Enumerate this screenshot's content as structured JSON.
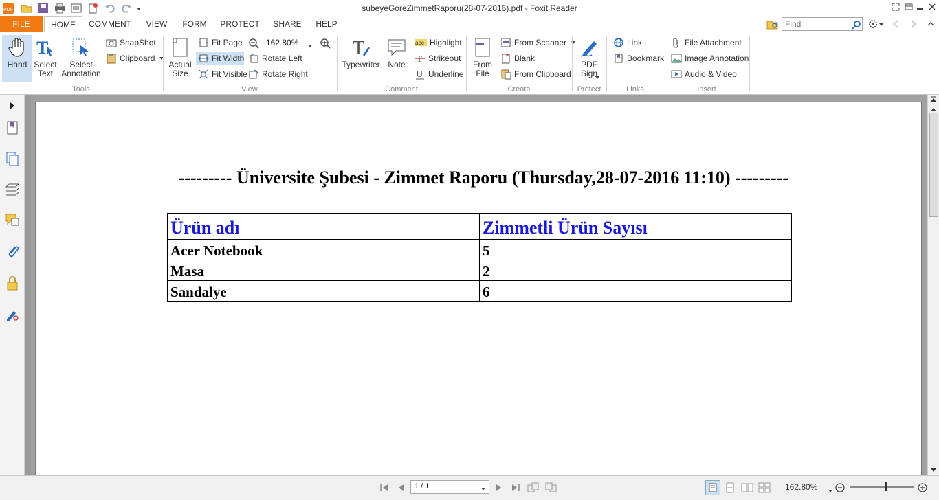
{
  "window": {
    "title": "subeyeGoreZimmetRaporu(28-07-2016).pdf - Foxit Reader"
  },
  "tabs": {
    "file": "FILE",
    "items": [
      "HOME",
      "COMMENT",
      "VIEW",
      "FORM",
      "PROTECT",
      "SHARE",
      "HELP"
    ],
    "active": "HOME"
  },
  "search": {
    "placeholder": "Find"
  },
  "ribbon": {
    "tools": {
      "hand": "Hand",
      "select_text": "Select\nText",
      "select_annotation": "Select\nAnnotation",
      "snapshot": "SnapShot",
      "clipboard": "Clipboard",
      "label": "Tools"
    },
    "view": {
      "actual_size": "Actual\nSize",
      "fit_page": "Fit Page",
      "fit_width": "Fit Width",
      "fit_visible": "Fit Visible",
      "zoom_value": "162.80%",
      "rotate_left": "Rotate Left",
      "rotate_right": "Rotate Right",
      "label": "View"
    },
    "comment": {
      "typewriter": "Typewriter",
      "note": "Note",
      "highlight": "Highlight",
      "strikeout": "Strikeout",
      "underline": "Underline",
      "label": "Comment"
    },
    "create": {
      "from_file": "From\nFile",
      "from_scanner": "From Scanner",
      "blank": "Blank",
      "from_clipboard": "From Clipboard",
      "label": "Create"
    },
    "protect": {
      "pdf_sign": "PDF\nSign",
      "label": "Protect"
    },
    "links": {
      "link": "Link",
      "bookmark": "Bookmark",
      "label": "Links"
    },
    "insert": {
      "file_attachment": "File Attachment",
      "image_annotation": "Image Annotation",
      "audio_video": "Audio & Video",
      "label": "Insert"
    }
  },
  "document": {
    "title": "--------- Üniversite Şubesi - Zimmet Raporu (Thursday,28-07-2016 11:10) ---------",
    "table": {
      "headers": [
        "Ürün adı",
        "Zimmetli Ürün Sayısı"
      ],
      "rows": [
        [
          "Acer Notebook",
          "5"
        ],
        [
          "Masa",
          "2"
        ],
        [
          "Sandalye",
          "6"
        ]
      ]
    }
  },
  "status": {
    "page": "1 / 1",
    "zoom": "162.80%"
  },
  "colors": {
    "file_tab": "#f07b12",
    "table_header": "#1a1ad6",
    "accent_blue": "#2b6cc4"
  }
}
